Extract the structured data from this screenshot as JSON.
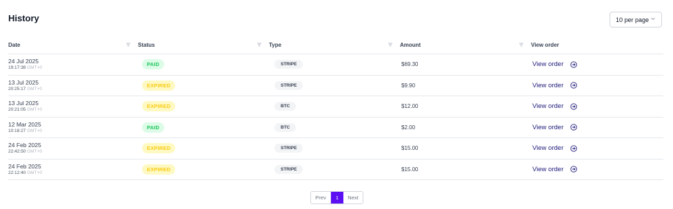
{
  "header": {
    "title": "History",
    "per_page": "10 per page"
  },
  "table": {
    "columns": [
      "Date",
      "Status",
      "Type",
      "Amount",
      "View order"
    ],
    "rows": [
      {
        "date": "24 Jul 2025",
        "time": "19:17:38",
        "tz": "GMT+0",
        "status": "PAID",
        "status_kind": "paid",
        "type": "STRIPE",
        "amount": "$69.30",
        "view": "View order"
      },
      {
        "date": "13 Jul 2025",
        "time": "20:25:17",
        "tz": "GMT+0",
        "status": "EXPIRED",
        "status_kind": "expired",
        "type": "STRIPE",
        "amount": "$9.90",
        "view": "View order"
      },
      {
        "date": "13 Jul 2025",
        "time": "20:21:05",
        "tz": "GMT+0",
        "status": "EXPIRED",
        "status_kind": "expired",
        "type": "BTC",
        "amount": "$12.00",
        "view": "View order"
      },
      {
        "date": "12 Mar 2025",
        "time": "10:18:27",
        "tz": "GMT+0",
        "status": "PAID",
        "status_kind": "paid",
        "type": "BTC",
        "amount": "$2.00",
        "view": "View order"
      },
      {
        "date": "24 Feb 2025",
        "time": "22:42:50",
        "tz": "GMT+0",
        "status": "EXPIRED",
        "status_kind": "expired",
        "type": "STRIPE",
        "amount": "$15.00",
        "view": "View order"
      },
      {
        "date": "24 Feb 2025",
        "time": "22:12:40",
        "tz": "GMT+0",
        "status": "EXPIRED",
        "status_kind": "expired",
        "type": "STRIPE",
        "amount": "$15.00",
        "view": "View order"
      }
    ]
  },
  "pagination": {
    "prev": "Prev",
    "current": "1",
    "next": "Next"
  },
  "colors": {
    "accent": "#5b0ff2",
    "link": "#1e1b7a",
    "paid_bg": "#dcfce7",
    "paid_fg": "#22c55e",
    "expired_bg": "#fef9c3",
    "expired_fg": "#facc15"
  },
  "icons": {
    "sort": "sort-icon",
    "dropdown": "chevron-down-icon",
    "view": "arrow-right-circle-icon"
  }
}
